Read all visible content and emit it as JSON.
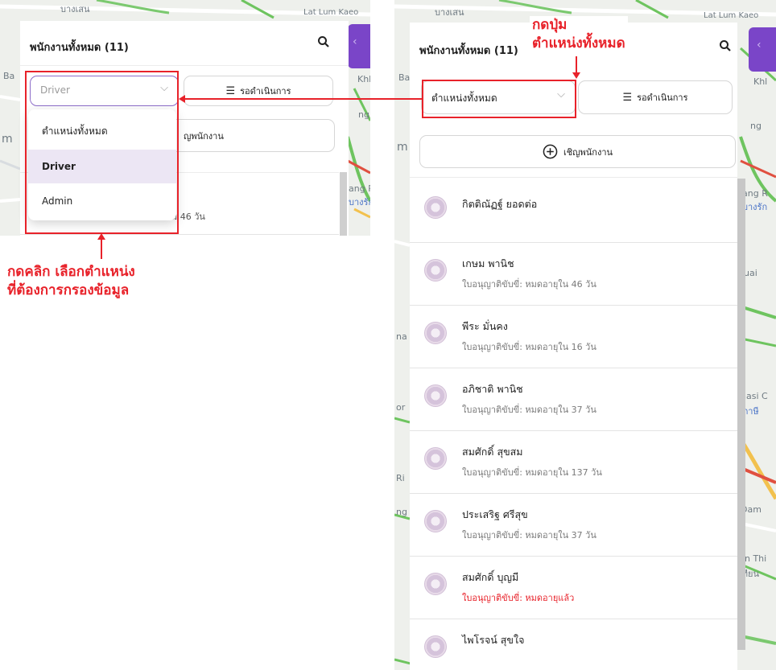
{
  "left_screen": {
    "header_title": "พนักงานทั้งหมด (11)",
    "position_dropdown_value": "Driver",
    "pending_button_label": "รอดำเนินการ",
    "invite_partial_label": "ญพนักงาน",
    "partial_license_text": "ม 46 วัน",
    "menu_items": [
      {
        "label": "ตำแหน่งทั้งหมด",
        "selected": false
      },
      {
        "label": "Driver",
        "selected": true
      },
      {
        "label": "Admin",
        "selected": false
      }
    ],
    "map_labels": [
      "บางเสน",
      "Lat Lum Kaeo",
      "Khl",
      "ng",
      "ang R",
      "บางรัก",
      "m",
      "Ba"
    ]
  },
  "right_screen": {
    "header_title": "พนักงานทั้งหมด (11)",
    "position_dropdown_value": "ตำแหน่งทั้งหมด",
    "pending_button_label": "รอดำเนินการ",
    "invite_button_label": "เชิญพนักงาน",
    "employees": [
      {
        "name": "กิตติณัฏฐ์ ยอดต่อ",
        "license": ""
      },
      {
        "name": "เกษม พานิช",
        "license": "ใบอนุญาติขับขี่: หมดอายุใน 46 วัน"
      },
      {
        "name": "พีระ มั่นคง",
        "license": "ใบอนุญาติขับขี่: หมดอายุใน 16 วัน"
      },
      {
        "name": "อภิชาติ พานิช",
        "license": "ใบอนุญาติขับขี่: หมดอายุใน 37 วัน"
      },
      {
        "name": "สมศักดิ์ สุขสม",
        "license": "ใบอนุญาติขับขี่: หมดอายุใน 137 วัน"
      },
      {
        "name": "ประเสริฐ ศรีสุข",
        "license": "ใบอนุญาติขับขี่: หมดอายุใน 37 วัน"
      },
      {
        "name": "สมศักดิ์ บุญมี",
        "license": "ใบอนุญาติขับขี่: หมดอายุแล้ว",
        "expired": true
      },
      {
        "name": "ไพโรจน์ สุขใจ",
        "license": ""
      }
    ],
    "map_labels": [
      "บางเสน",
      "Lat Lum Kaeo",
      "Khl",
      "ng",
      "ang R",
      "บางรัก",
      "uai",
      "nasi C",
      "ภาษี",
      "Dam",
      "un Thi",
      "เทียน",
      "na",
      "Ri",
      "ng",
      "or",
      "m",
      "Ba"
    ]
  },
  "annotations": {
    "left_note_line1": "กดคลิก เลือกตำแหน่ง",
    "left_note_line2": "ที่ต้องการกรองข้อมูล",
    "right_note_line1": "กดปุ่ม",
    "right_note_line2": "ตำแหน่งทั้งหมด"
  },
  "colors": {
    "accent_purple": "#7a45c8",
    "annotation_red": "#e8222a",
    "selected_item_bg": "#ece6f4"
  }
}
